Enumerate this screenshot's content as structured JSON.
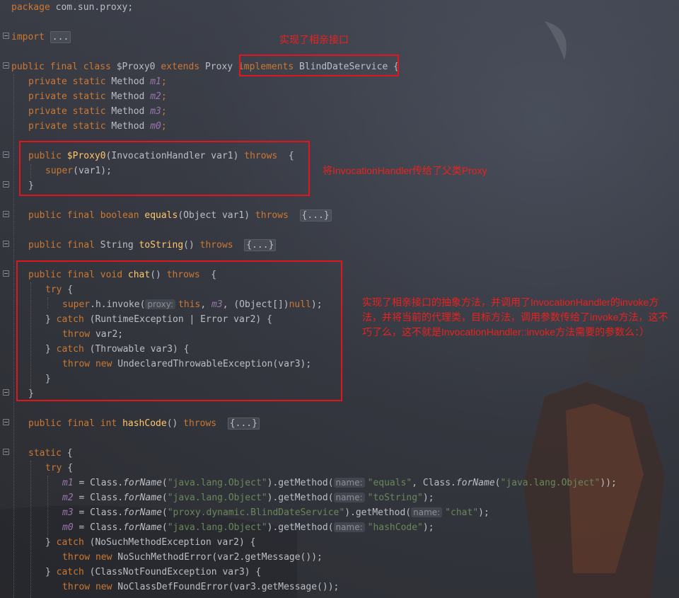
{
  "code": {
    "package_kw": "package",
    "package_name": " com.sun.proxy;",
    "import_kw": "import",
    "import_fold": "...",
    "class_prefix": "public final class $Proxy0 extends Proxy ",
    "implements_kw": "implements",
    "interface_name": " BlindDateService",
    "open_brace": " {",
    "fields": [
      {
        "mod": "private static",
        "type": " Method ",
        "name": "m1",
        "end": ";"
      },
      {
        "mod": "private static",
        "type": " Method ",
        "name": "m2",
        "end": ";"
      },
      {
        "mod": "private static",
        "type": " Method ",
        "name": "m3",
        "end": ";"
      },
      {
        "mod": "private static",
        "type": " Method ",
        "name": "m0",
        "end": ";"
      }
    ],
    "ctor_public": "public ",
    "ctor_name": "$Proxy0",
    "ctor_params": "(InvocationHandler var1) ",
    "throws_kw": "throws",
    "ctor_open": "  {",
    "super_kw": "super",
    "super_args": "(var1);",
    "close_brace": "}",
    "equals_mod": "public final boolean ",
    "equals_name": "equals",
    "equals_params": "(Object var1) ",
    "fold_body": "{...}",
    "tostring_mod": "public final ",
    "tostring_type": "String ",
    "tostring_name": "toString",
    "tostring_params": "() ",
    "chat_mod": "public final void ",
    "chat_name": "chat",
    "chat_params": "() ",
    "chat_open": "  {",
    "try_kw": "try",
    "try_open": " {",
    "invoke_super": "super",
    "invoke_h": ".h.invoke(",
    "hint_proxy": "proxy:",
    "invoke_this": "this",
    "invoke_sep": ", ",
    "invoke_m3": "m3",
    "invoke_rest": ", (Object[])",
    "null_kw": "null",
    "invoke_end": ");",
    "catch1_pre": "} ",
    "catch_kw": "catch",
    "catch1_rest": " (RuntimeException | Error var2) {",
    "throw_kw": "throw",
    "throw1_rest": " var2;",
    "catch2_rest": " (Throwable var3) {",
    "new_kw": "new",
    "throw2_rest": " UndeclaredThrowableException(var3);",
    "hashcode_mod": "public final int ",
    "hashcode_name": "hashCode",
    "hashcode_params": "() ",
    "static_kw": "static",
    "class_ref": "Class.",
    "forname": "forName",
    "getmethod": ".getMethod(",
    "hint_name": "name:",
    "str_object": "\"java.lang.Object\"",
    "str_service": "\"proxy.dynamic.BlindDateService\"",
    "str_equals": "\"equals\"",
    "str_tostring": "\"toString\"",
    "str_chat": "\"chat\"",
    "str_hashcode": "\"hashCode\"",
    "m0": "m0",
    "m1": "m1",
    "m2": "m2",
    "eq": " = ",
    "open_paren": "(",
    "close_paren": ")",
    "comma": ", ",
    "close_paren_semi": ");",
    "double_close_semi": "));",
    "catch3_rest": " (NoSuchMethodException var2) {",
    "throw3_rest": " NoSuchMethodError(var2.getMessage());",
    "catch4_rest": " (ClassNotFoundException var3) {",
    "throw4_rest": " NoClassDefFoundError(var3.getMessage());"
  },
  "annotations": {
    "note1": "实现了相亲接口",
    "note2": "将InvocationHandler传给了父类Proxy",
    "note3": "实现了相亲接口的抽象方法，并调用了InvocationHandler的invoke方法，并将当前的代理类，目标方法，调用参数传给了invoke方法，这不巧了么，这不就是InvocationHandler::invoke方法需要的参数么：）",
    "color": "#e0161f"
  }
}
